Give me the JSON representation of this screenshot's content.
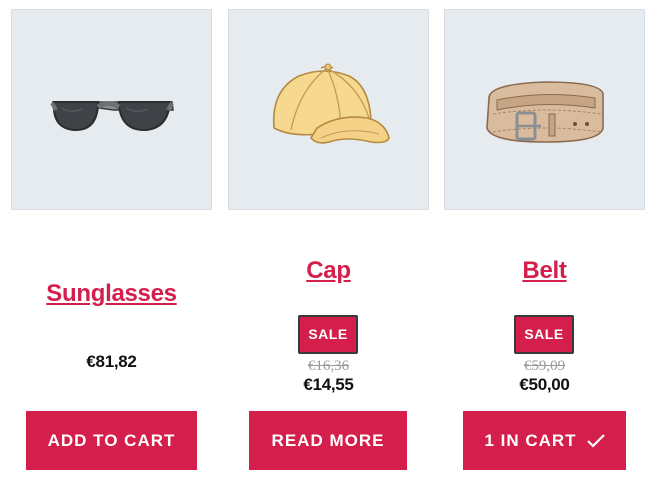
{
  "products": [
    {
      "name": "Sunglasses",
      "price": "€81,82",
      "button_label": "ADD TO CART",
      "image_icon": "sunglasses-icon"
    },
    {
      "name": "Cap",
      "sale_badge": "SALE",
      "old_price": "€16,36",
      "price": "€14,55",
      "button_label": "READ MORE",
      "image_icon": "cap-icon"
    },
    {
      "name": "Belt",
      "sale_badge": "SALE",
      "old_price": "€59,09",
      "price": "€50,00",
      "button_label": "1 IN CART",
      "button_icon": "checkmark-icon",
      "image_icon": "belt-icon"
    }
  ],
  "colors": {
    "accent": "#d41e4b",
    "image_background": "#e6ebf0",
    "price_text": "#111111",
    "old_price_text": "#9a9a9a"
  }
}
